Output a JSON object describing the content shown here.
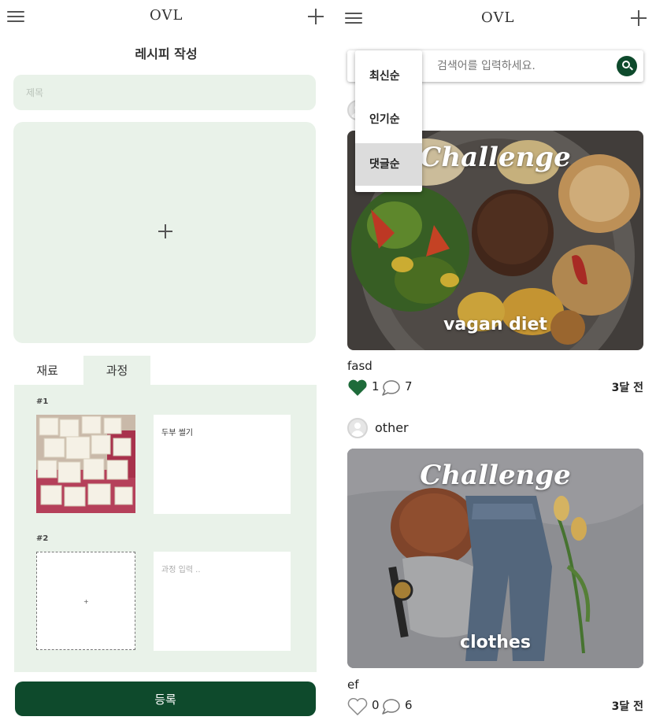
{
  "left": {
    "header": {
      "logo": "OVL"
    },
    "page_title": "레시피 작성",
    "title_placeholder": "제목",
    "tabs": [
      {
        "label": "재료"
      },
      {
        "label": "과정"
      }
    ],
    "steps": [
      {
        "number": "#1",
        "text": "두부 썰기",
        "placeholder": ""
      },
      {
        "number": "#2",
        "text": "",
        "placeholder": "과정 입력 ..",
        "add_icon": "+"
      }
    ],
    "submit_label": "등록",
    "colors": {
      "accent": "#0e4a2c",
      "panel": "#e9f2e9"
    }
  },
  "right": {
    "header": {
      "logo": "OVL"
    },
    "search": {
      "placeholder": "검색어를 입력하세요."
    },
    "sort_menu": {
      "items": [
        {
          "label": "최신순"
        },
        {
          "label": "인기순"
        },
        {
          "label": "댓글순"
        }
      ],
      "selected": "댓글순"
    },
    "posts": [
      {
        "author": "",
        "image_title": "Challenge",
        "image_caption": "vagan diet",
        "title": "fasd",
        "liked": true,
        "likes": "1",
        "comments": "7",
        "time": "3달 전"
      },
      {
        "author": "other",
        "image_title": "Challenge",
        "image_caption": "clothes",
        "title": "ef",
        "liked": false,
        "likes": "0",
        "comments": "6",
        "time": "3달 전"
      }
    ]
  }
}
